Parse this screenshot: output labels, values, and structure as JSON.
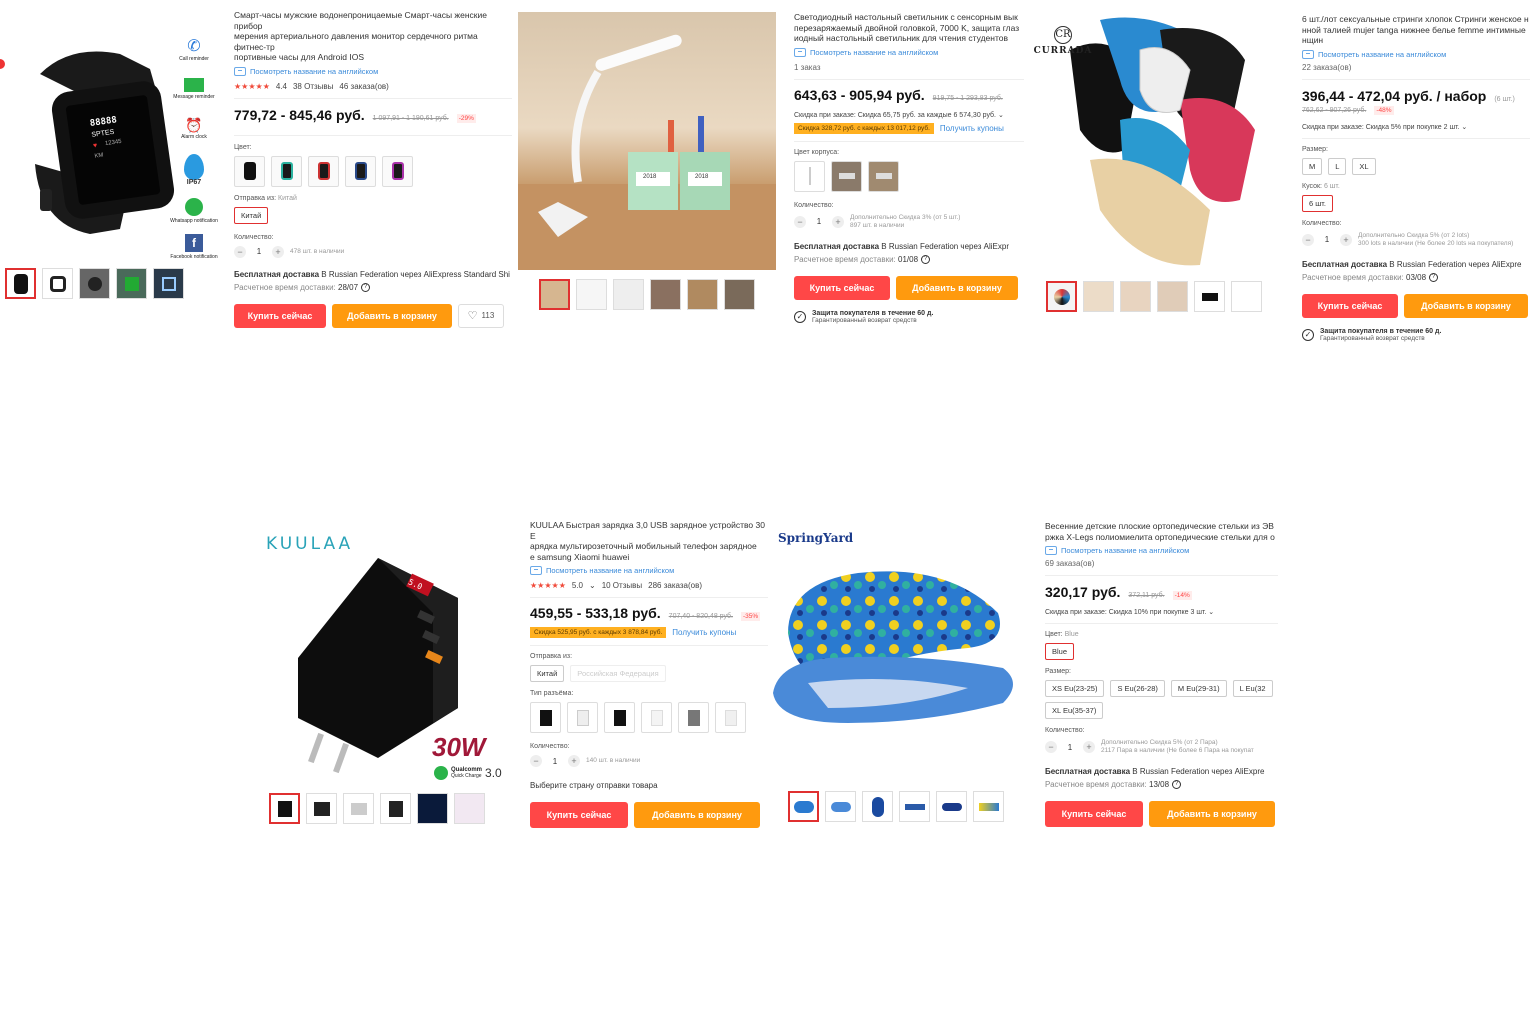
{
  "p1": {
    "title": "Смарт-часы мужские водонепроницаемые Смарт-часы женские прибор\nмерения артериального давления монитор сердечного ритма фитнес-тр\nпортивные часы для Android IOS",
    "english_link": "Посмотреть название на английском",
    "rating": "4.4",
    "reviews": "38 Отзывы",
    "orders": "46 заказа(ов)",
    "price": "779,72 - 845,46 руб.",
    "old_price": "1 097,91 - 1 190,61 руб.",
    "discount": "-29%",
    "color_label": "Цвет:",
    "ship_from_label": "Отправка из:",
    "ship_from_value": "Китай",
    "ship_from_chip": "Китай",
    "qty_label": "Количество:",
    "qty": "1",
    "qty_note": "478 шт. в наличии",
    "shipping_bold": "Бесплатная доставка",
    "shipping_rest": "В Russian Federation через AliExpress Standard Shi",
    "eta_label": "Расчетное время доставки:",
    "eta": "28/07",
    "buy": "Купить сейчас",
    "cart": "Добавить в корзину",
    "wish_count": "113",
    "watch_features": [
      "Call reminder",
      "Message reminder",
      "Alarm clock",
      "IP67",
      "Whatsapp notification",
      "Facebook notification"
    ],
    "watch_screen": [
      "88888",
      "SPTES",
      "12345",
      "KM"
    ]
  },
  "p2": {
    "title": "Светодиодный настольный светильник с сенсорным вык\nперезаряжаемый двойной головкой, 7000 K, защита глаз\nиодный настольный светильник для чтения студентов",
    "english_link": "Посмотреть название на английском",
    "orders": "1 заказ",
    "price": "643,63 - 905,94 руб.",
    "old_price": "919,75 - 1 293,83 руб.",
    "order_discount": "Скидка при заказе: Скидка 65,75 руб. за каждые 6 574,30 руб.",
    "coupon": "Скидка 328,72 руб. с каждых 13 017,12 руб.",
    "coupon_link": "Получить купоны",
    "color_label": "Цвет корпуса:",
    "qty_label": "Количество:",
    "qty": "1",
    "qty_note_1": "Дополнительно Скидка 3% (от 5 шт.)",
    "qty_note_2": "897 шт. в наличии",
    "shipping_bold": "Бесплатная доставка",
    "shipping_rest": "В Russian Federation через AliExpr",
    "eta_label": "Расчетное время доставки:",
    "eta": "01/08",
    "buy": "Купить сейчас",
    "cart": "Добавить в корзину",
    "protect_1": "Защита покупателя в течение 60 д.",
    "protect_2": "Гарантированный возврат средств",
    "clock_text": "2018"
  },
  "p3": {
    "brand": "CURRADA",
    "title": "6 шт./лот сексуальные стринги хлопок Стринги женское н\nнной талией mujer tanga нижнее белье femme интимные\nнщин",
    "english_link": "Посмотреть название на английском",
    "orders": "22 заказа(ов)",
    "price": "396,44 - 472,04 руб. / набор",
    "unit": "(6 шт.)",
    "old_price": "762,62 - 907,26 руб.",
    "discount": "-48%",
    "order_discount": "Скидка при заказе: Скидка 5% при покупке 2 шт.",
    "size_label": "Размер:",
    "sizes": [
      "M",
      "L",
      "XL"
    ],
    "piece_label": "Кусок:",
    "piece_value": "6 шт.",
    "piece_chip": "6 шт.",
    "qty_label": "Количество:",
    "qty": "1",
    "qty_note_1": "Дополнительно Скидка 5% (от 2 lots)",
    "qty_note_2": "300 lots в наличии (Не более 20 lots на покупателя)",
    "shipping_bold": "Бесплатная доставка",
    "shipping_rest": "В Russian Federation через AliExpre",
    "eta_label": "Расчетное время доставки:",
    "eta": "03/08",
    "buy": "Купить сейчас",
    "cart": "Добавить в корзину",
    "protect_1": "Защита покупателя в течение 60 д.",
    "protect_2": "Гарантированный возврат средств"
  },
  "p4": {
    "brand": "KUULAA",
    "title": "KUULAA Быстрая зарядка 3,0 USB зарядное устройство 30 E\nарядка мультирозеточный мобильный телефон зарядное\nе samsung Xiaomi huawei",
    "english_link": "Посмотреть название на английском",
    "rating": "5.0",
    "reviews": "10 Отзывы",
    "orders": "286 заказа(ов)",
    "price": "459,55 - 533,18 руб.",
    "old_price": "707,40 - 820,48 руб.",
    "discount": "-35%",
    "coupon": "Скидка 525,95 руб. с каждых 3 878,84 руб.",
    "coupon_link": "Получить купоны",
    "ship_from_label": "Отправка из:",
    "ship_from_chips": [
      "Китай",
      "Российская Федерация"
    ],
    "plug_label": "Тип разъёма:",
    "qty_label": "Количество:",
    "qty": "1",
    "qty_note": "140 шт. в наличии",
    "select_country": "Выберите страну отправки товара",
    "buy": "Купить сейчас",
    "cart": "Добавить в корзину",
    "wattage": "30W",
    "qc_1": "Qualcomm",
    "qc_2": "Quick Charge",
    "qc_3": "3.0",
    "display": "5.0"
  },
  "p5": {
    "brand": "SpringYard",
    "title": "Весенние детские плоские ортопедические стельки из ЭВ\nржка X-Legs полиомиелита ортопедические стельки для о",
    "english_link": "Посмотреть название на английском",
    "orders": "69 заказа(ов)",
    "price": "320,17 руб.",
    "old_price": "372,11 руб.",
    "discount": "-14%",
    "order_discount": "Скидка при заказе: Скидка 10% при покупке 3 шт.",
    "color_label": "Цвет:",
    "color_value": "Blue",
    "color_chip": "Blue",
    "size_label": "Размер:",
    "sizes": [
      "XS Eu(23-25)",
      "S Eu(26-28)",
      "M Eu(29-31)",
      "L Eu(32",
      "XL Eu(35-37)"
    ],
    "qty_label": "Количество:",
    "qty": "1",
    "qty_note_1": "Дополнительно Скидка 5% (от 2 Пара)",
    "qty_note_2": "2117 Пара в наличии (Не более 6 Пара на покупат",
    "shipping_bold": "Бесплатная доставка",
    "shipping_rest": "В Russian Federation через AliExpre",
    "eta_label": "Расчетное время доставки:",
    "eta": "13/08",
    "buy": "Купить сейчас",
    "cart": "Добавить в корзину"
  },
  "colors": {
    "accent_red": "#ff4747",
    "accent_orange": "#ff9a0e",
    "link_blue": "#3a8ad9",
    "coupon_yellow": "#ffb020"
  }
}
